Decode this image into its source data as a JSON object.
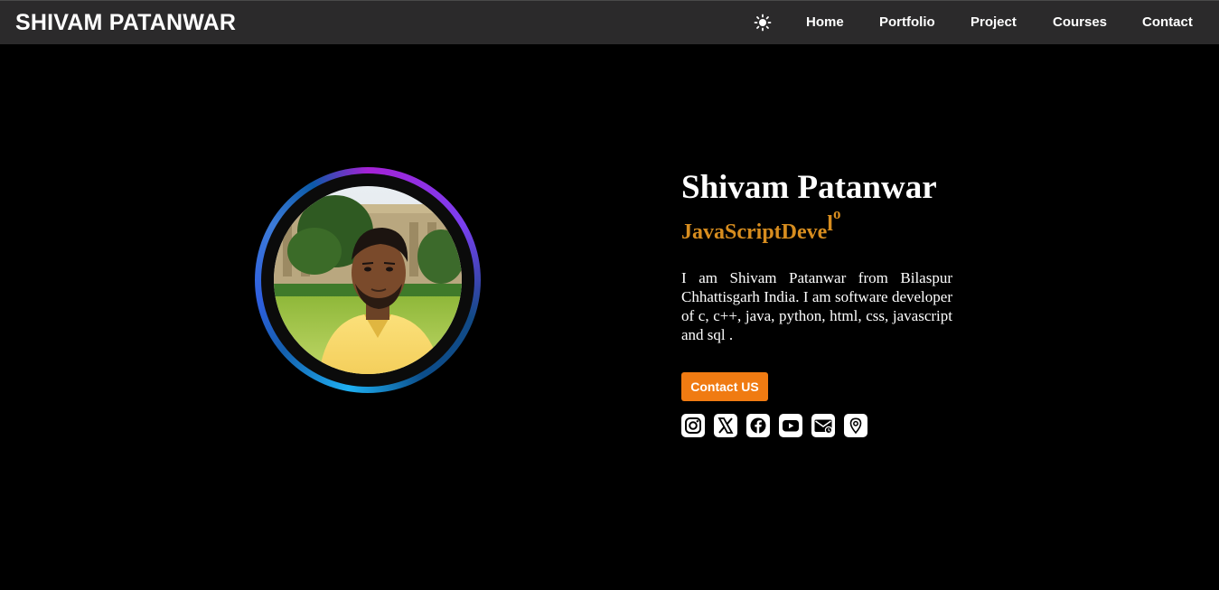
{
  "navbar": {
    "brand": "SHIVAM PATANWAR",
    "theme_icon": "sun-icon",
    "links": [
      {
        "label": "Home"
      },
      {
        "label": "Portfolio"
      },
      {
        "label": "Project"
      },
      {
        "label": "Courses"
      },
      {
        "label": "Contact"
      }
    ]
  },
  "hero": {
    "name": "Shivam Patanwar",
    "typing_text": {
      "main": "JavaScriptDeve",
      "part2": "l",
      "part3": "o"
    },
    "bio": "I am Shivam Patanwar from Bilaspur Chhattisgarh India. I am software developer of c, c++, java, python, html, css, javascript and sql .",
    "contact_button": "Contact US",
    "social_icons": [
      "instagram-icon",
      "x-twitter-icon",
      "facebook-icon",
      "youtube-icon",
      "email-icon",
      "location-icon"
    ]
  },
  "colors": {
    "background": "#000000",
    "navbar": "#2b2a2b",
    "accent_orange": "#f07b12",
    "typing_gold": "#d78d1f",
    "ring_purple": "#a522d6",
    "ring_blue": "#1fb0f2"
  }
}
